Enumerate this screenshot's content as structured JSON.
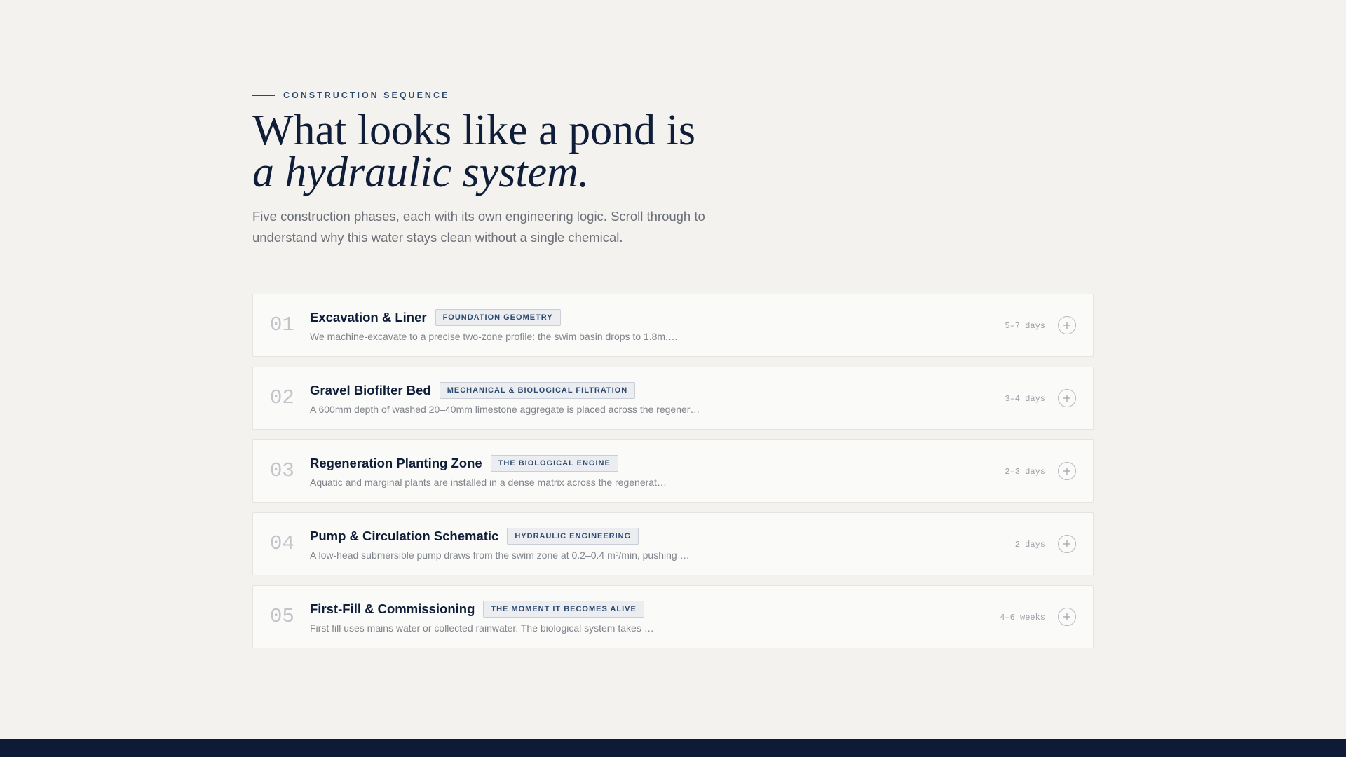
{
  "header": {
    "eyebrow": "CONSTRUCTION SEQUENCE",
    "headline_line1": "What looks like a pond is",
    "headline_line2": "a hydraulic system.",
    "intro": "Five construction phases, each with its own engineering logic. Scroll through to understand why this water stays clean without a single chemical."
  },
  "phases": [
    {
      "number": "01",
      "title": "Excavation & Liner",
      "tag": "FOUNDATION GEOMETRY",
      "description": "We machine-excavate to a precise two-zone profile: the swim basin drops to 1.8m,…",
      "duration": "5–7 days",
      "icon": "plus-icon"
    },
    {
      "number": "02",
      "title": "Gravel Biofilter Bed",
      "tag": "MECHANICAL & BIOLOGICAL FILTRATION",
      "description": "A 600mm depth of washed 20–40mm limestone aggregate is placed across the regener…",
      "duration": "3–4 days",
      "icon": "plus-icon"
    },
    {
      "number": "03",
      "title": "Regeneration Planting Zone",
      "tag": "THE BIOLOGICAL ENGINE",
      "description": "Aquatic and marginal plants are installed in a dense matrix across the regenerat…",
      "duration": "2–3 days",
      "icon": "plus-icon"
    },
    {
      "number": "04",
      "title": "Pump & Circulation Schematic",
      "tag": "HYDRAULIC ENGINEERING",
      "description": "A low-head submersible pump draws from the swim zone at 0.2–0.4 m³/min, pushing …",
      "duration": "2 days",
      "icon": "plus-icon"
    },
    {
      "number": "05",
      "title": "First-Fill & Commissioning",
      "tag": "THE MOMENT IT BECOMES ALIVE",
      "description": "First fill uses mains water or collected rainwater. The biological system takes …",
      "duration": "4–6 weeks",
      "icon": "plus-icon"
    }
  ],
  "colors": {
    "background": "#f4f2ee",
    "ink": "#0f1d38",
    "accent": "#2c4a6e",
    "footer": "#0e1b36"
  }
}
